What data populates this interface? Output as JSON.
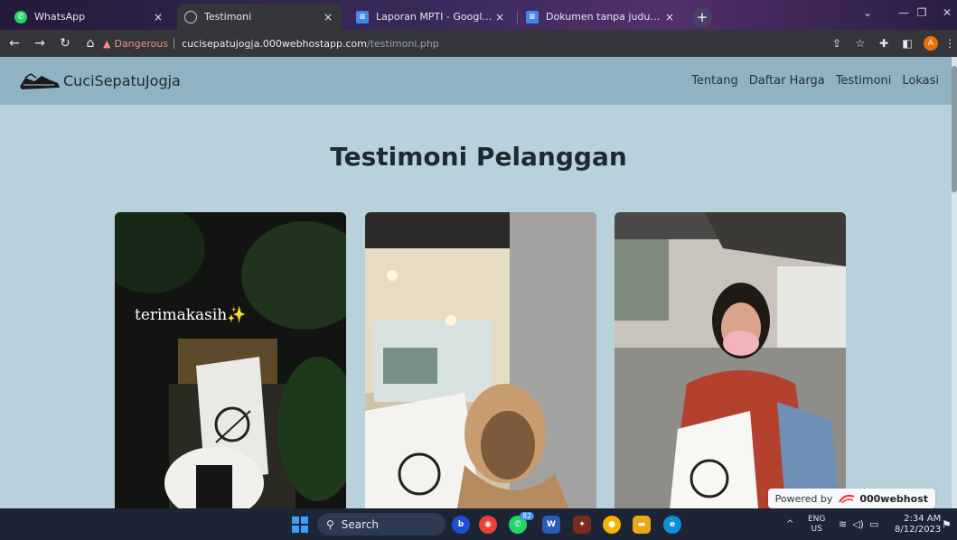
{
  "browser": {
    "tabs": [
      {
        "title": "WhatsApp",
        "icon": "whatsapp-icon",
        "active": false
      },
      {
        "title": "Testimoni",
        "icon": "globe-icon",
        "active": true
      },
      {
        "title": "Laporan MPTI - Google Dokumen",
        "icon": "google-docs-icon",
        "active": false
      },
      {
        "title": "Dokumen tanpa judul - Google Dokumen",
        "icon": "google-docs-icon",
        "active": false
      }
    ],
    "tab_close_glyph": "×",
    "new_tab_glyph": "+",
    "security_label": "Dangerous",
    "url_host": "cucisepatujogja.000webhostapp.com",
    "url_path": "/testimoni.php",
    "profile_initial": "A"
  },
  "site": {
    "brand_name": "CuciSepatuJogja",
    "nav": [
      "Tentang",
      "Daftar Harga",
      "Testimoni",
      "Lokasi"
    ],
    "heading": "Testimoni Pelanggan",
    "cards": [
      {
        "overlay_text": "terimakasih✨"
      },
      {
        "overlay_text": ""
      },
      {
        "overlay_text": ""
      }
    ],
    "badge_prefix": "Powered by",
    "badge_brand": "000webhost"
  },
  "taskbar": {
    "search_label": "Search",
    "language_top": "ENG",
    "language_bottom": "US",
    "time": "2:34 AM",
    "date": "8/12/2023",
    "whatsapp_badge": "82"
  },
  "colors": {
    "page_bg": "#b8d1db",
    "navbar_bg": "#8fb3c2",
    "danger": "#f28b82"
  }
}
